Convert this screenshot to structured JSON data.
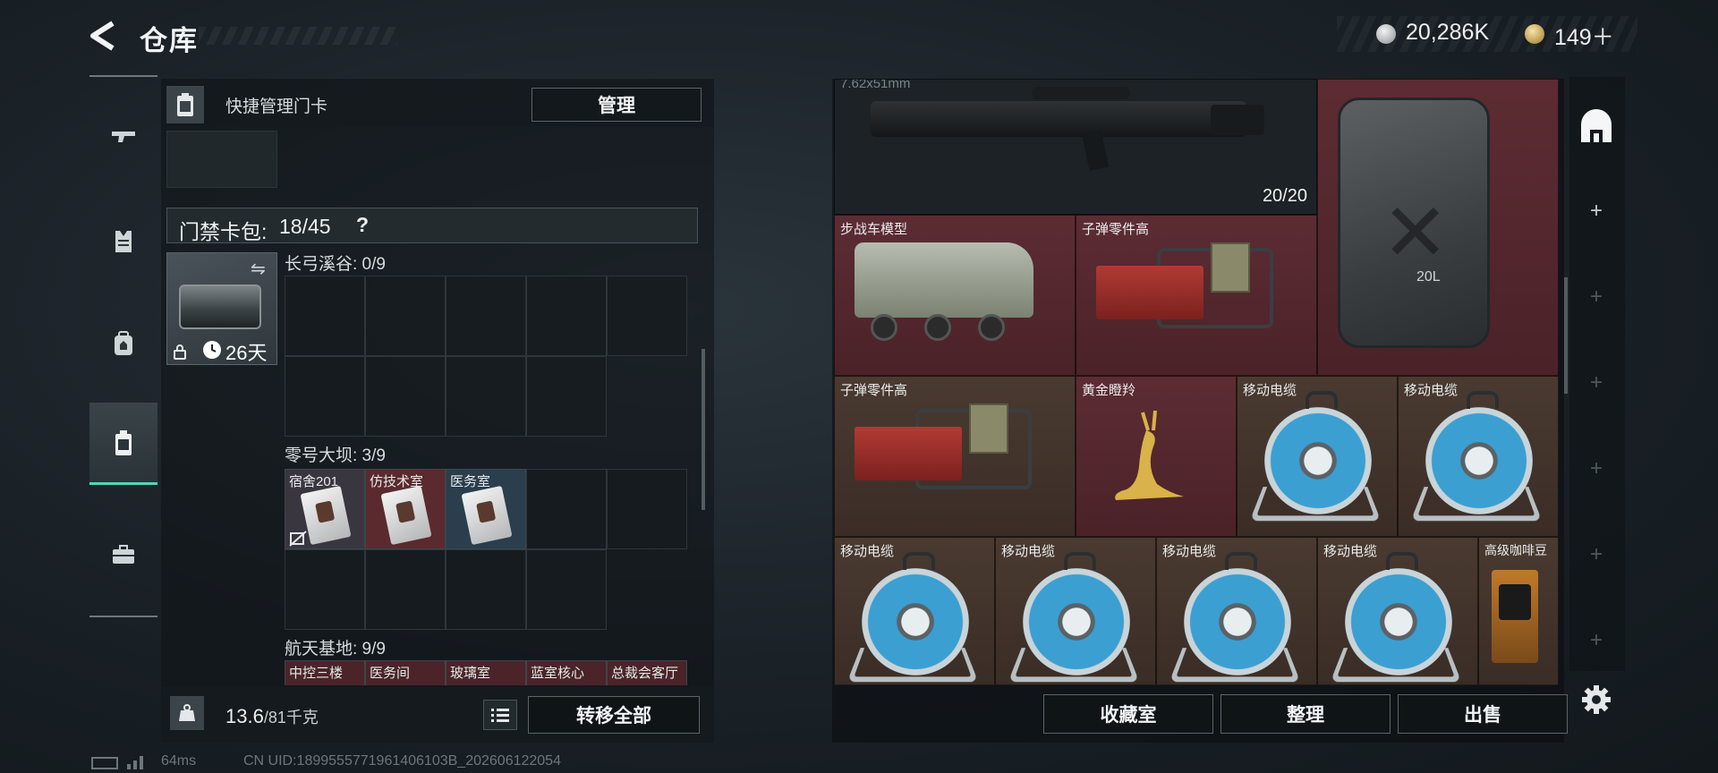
{
  "header": {
    "title": "仓库",
    "currency": [
      {
        "icon": "silver-coin-icon",
        "value": "20,286K"
      },
      {
        "icon": "gold-coin-icon",
        "value": "149＋"
      }
    ],
    "corner_text": "64ms"
  },
  "sidebar": {
    "tabs": [
      {
        "name": "weapons",
        "icon": "gun-icon"
      },
      {
        "name": "armor",
        "icon": "vest-icon"
      },
      {
        "name": "backpack",
        "icon": "backpack-icon"
      },
      {
        "name": "keycards",
        "icon": "keycard-icon",
        "active": true
      },
      {
        "name": "supplies",
        "icon": "toolbox-icon"
      }
    ]
  },
  "left": {
    "quick_manage_label": "快捷管理门卡",
    "manage_button": "管理",
    "keybag_label": "门禁卡包:",
    "keybag_value": "18/45",
    "keybag_help": "?",
    "keycase_days": "26天",
    "sections": [
      {
        "label": "长弓溪谷: 0/9"
      },
      {
        "label": "零号大坝: 3/9",
        "cards": [
          {
            "label": "宿舍201",
            "color": "#3a3640"
          },
          {
            "label": "仿技术室",
            "color": "#5a2a2e"
          },
          {
            "label": "医务室",
            "color": "#2a3e4e"
          }
        ]
      },
      {
        "label": "航天基地: 9/9",
        "cards": [
          {
            "label": "中控三楼"
          },
          {
            "label": "医务间"
          },
          {
            "label": "玻璃室"
          },
          {
            "label": "蓝室核心"
          },
          {
            "label": "总裁会客厅"
          }
        ]
      }
    ],
    "weight_value": "13.6",
    "weight_max": "/81千克",
    "transfer_button": "转移全部"
  },
  "right": {
    "weapon_caption": "7.62x51mm",
    "weapon_ammo": "20/20",
    "items": [
      {
        "label": "步战车模型",
        "bg": "red"
      },
      {
        "label": "子弹零件高",
        "bg": "red"
      },
      {
        "label": "子弹零件高",
        "bg": "brown"
      },
      {
        "label": "黄金瞪羚",
        "bg": "red"
      },
      {
        "label": "移动电缆",
        "bg": "brown"
      },
      {
        "label": "移动电缆",
        "bg": "brown"
      },
      {
        "label": "移动电缆",
        "bg": "brown"
      },
      {
        "label": "移动电缆",
        "bg": "brown"
      },
      {
        "label": "移动电缆",
        "bg": "brown"
      },
      {
        "label": "移动电缆",
        "bg": "brown"
      },
      {
        "label": "高级咖啡豆",
        "bg": "brown"
      }
    ],
    "jerrycan_text": "20L",
    "buttons": {
      "collection": "收藏室",
      "organize": "整理",
      "sell": "出售"
    }
  },
  "footer": {
    "ping": "64ms",
    "uid": "CN UID:1899555771961406103B_202606122054"
  }
}
